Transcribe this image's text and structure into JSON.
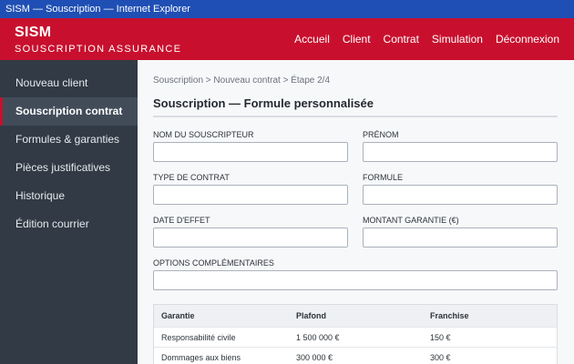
{
  "window": {
    "title": "SISM — Souscription — Internet Explorer"
  },
  "header": {
    "brand": "SISM",
    "subtitle": "SOUSCRIPTION ASSURANCE",
    "nav": [
      "Accueil",
      "Client",
      "Contrat",
      "Simulation",
      "Déconnexion"
    ]
  },
  "sidebar": {
    "items": [
      {
        "label": "Nouveau client",
        "active": false
      },
      {
        "label": "Souscription contrat",
        "active": true
      },
      {
        "label": "Formules & garanties",
        "active": false
      },
      {
        "label": "Pièces justificatives",
        "active": false
      },
      {
        "label": "Historique",
        "active": false
      },
      {
        "label": "Édition courrier",
        "active": false
      }
    ]
  },
  "main": {
    "breadcrumb": "Souscription > Nouveau contrat > Étape 2/4",
    "title": "Souscription — Formule personnalisée",
    "fields": {
      "nom": {
        "label": "NOM DU SOUSCRIPTEUR",
        "value": ""
      },
      "prenom": {
        "label": "PRÉNOM",
        "value": ""
      },
      "type_contrat": {
        "label": "TYPE DE CONTRAT",
        "value": ""
      },
      "formule": {
        "label": "FORMULE",
        "value": ""
      },
      "date_effet": {
        "label": "DATE D'EFFET",
        "value": ""
      },
      "montant": {
        "label": "MONTANT GARANTIE (€)",
        "value": ""
      },
      "options": {
        "label": "OPTIONS COMPLÉMENTAIRES",
        "value": ""
      }
    },
    "table": {
      "headers": [
        "Garantie",
        "Plafond",
        "Franchise"
      ],
      "rows": [
        [
          "Responsabilité civile",
          "1 500 000 €",
          "150 €"
        ],
        [
          "Dommages aux biens",
          "300 000 €",
          "300 €"
        ]
      ]
    }
  },
  "colors": {
    "brand": "#c8102e",
    "sidebar": "#313a45",
    "titlebar": "#1f4fb4"
  }
}
